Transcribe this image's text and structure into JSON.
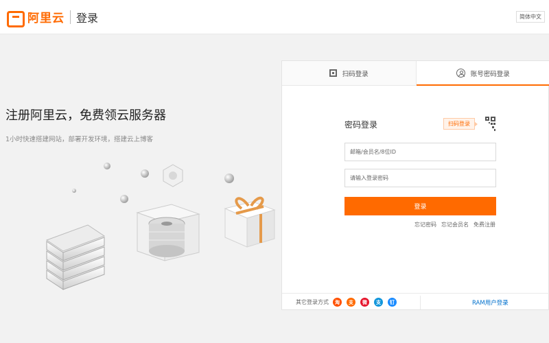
{
  "header": {
    "brand": "阿里云",
    "title": "登录",
    "language": "简体中文"
  },
  "promo": {
    "title": "注册阿里云，免费领云服务器",
    "subtitle": "1小时快速搭建网站，部署开发环境，搭建云上博客"
  },
  "login": {
    "tabs": [
      {
        "label": "扫码登录",
        "icon": "qr-code-icon",
        "active": false
      },
      {
        "label": "账号密码登录",
        "icon": "user-icon",
        "active": true
      }
    ],
    "form_title": "密码登录",
    "qr_tip": "扫码登录",
    "username_placeholder": "邮箱/会员名/8位ID",
    "password_placeholder": "请输入登录密码",
    "submit_label": "登录",
    "links": [
      "忘记密码",
      "忘记会员名",
      "免费注册"
    ],
    "other_methods_label": "其它登录方式",
    "social": [
      {
        "icon": "taobao-icon",
        "glyph": "淘",
        "color": "#ff5000"
      },
      {
        "icon": "alipay-icon",
        "glyph": "支",
        "color": "#ff6a00"
      },
      {
        "icon": "weibo-icon",
        "glyph": "微",
        "color": "#e6162d"
      },
      {
        "icon": "alipay-blue-icon",
        "glyph": "支",
        "color": "#1296db"
      },
      {
        "icon": "dingtalk-icon",
        "glyph": "钉",
        "color": "#1a8bff"
      }
    ],
    "ram_link": "RAM用户登录"
  },
  "colors": {
    "accent": "#ff6a00",
    "link": "#0070cc"
  }
}
